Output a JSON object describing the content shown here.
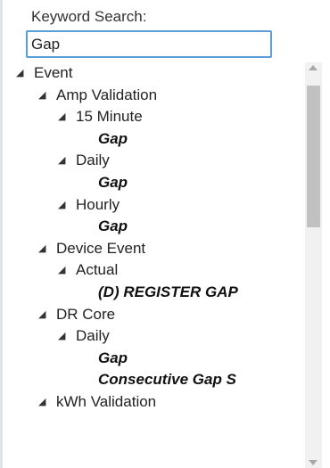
{
  "search": {
    "label": "Keyword Search:",
    "value": "Gap"
  },
  "tree": {
    "expanded_glyph": "◢",
    "nodes": [
      {
        "label": "Event",
        "level": 0,
        "type": "branch"
      },
      {
        "label": "Amp Validation",
        "level": 1,
        "type": "branch"
      },
      {
        "label": "15 Minute",
        "level": 2,
        "type": "branch"
      },
      {
        "label": "Gap",
        "level": 3,
        "type": "leaf"
      },
      {
        "label": "Daily",
        "level": 2,
        "type": "branch"
      },
      {
        "label": "Gap",
        "level": 3,
        "type": "leaf"
      },
      {
        "label": "Hourly",
        "level": 2,
        "type": "branch"
      },
      {
        "label": "Gap",
        "level": 3,
        "type": "leaf"
      },
      {
        "label": "Device Event",
        "level": 1,
        "type": "branch"
      },
      {
        "label": "Actual",
        "level": 2,
        "type": "branch"
      },
      {
        "label": "(D) REGISTER GAP",
        "level": 3,
        "type": "leaf"
      },
      {
        "label": "DR Core",
        "level": 1,
        "type": "branch"
      },
      {
        "label": "Daily",
        "level": 2,
        "type": "branch"
      },
      {
        "label": "Gap",
        "level": 3,
        "type": "leaf"
      },
      {
        "label": "Consecutive Gap S",
        "level": 3,
        "type": "leaf"
      },
      {
        "label": "kWh Validation",
        "level": 1,
        "type": "branch"
      }
    ]
  }
}
